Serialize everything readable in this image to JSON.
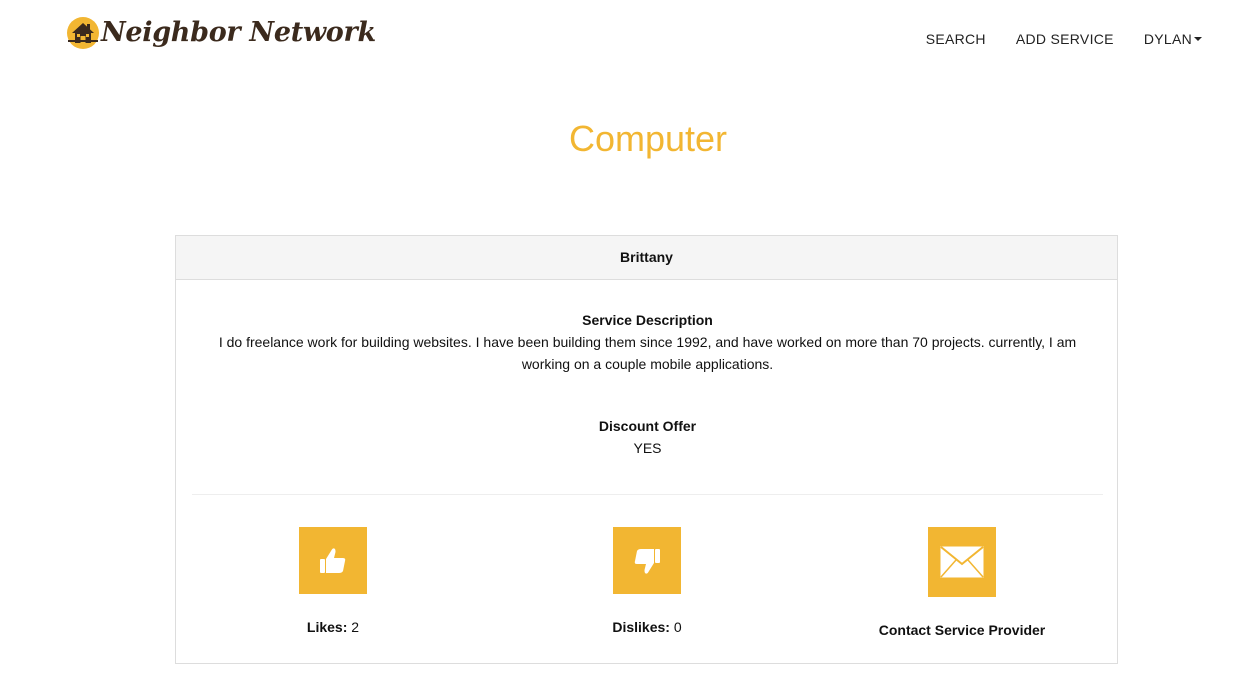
{
  "brand": {
    "name": "Neighbor Network",
    "logo_icon": "house-icon"
  },
  "nav": {
    "search": "SEARCH",
    "add_service": "ADD SERVICE",
    "user": "DYLAN"
  },
  "page": {
    "title": "Computer"
  },
  "service": {
    "provider": "Brittany",
    "description_label": "Service Description",
    "description": "I do freelance work for building websites. I have been building them since 1992, and have worked on more than 70 projects. currently, I am working on a couple mobile applications.",
    "discount_label": "Discount Offer",
    "discount_value": "YES"
  },
  "actions": {
    "likes_label": "Likes:",
    "likes_count": "2",
    "dislikes_label": "Dislikes:",
    "dislikes_count": "0",
    "contact_label": "Contact Service Provider"
  },
  "colors": {
    "accent": "#f2b632",
    "brand_text": "#3b2a1d"
  }
}
